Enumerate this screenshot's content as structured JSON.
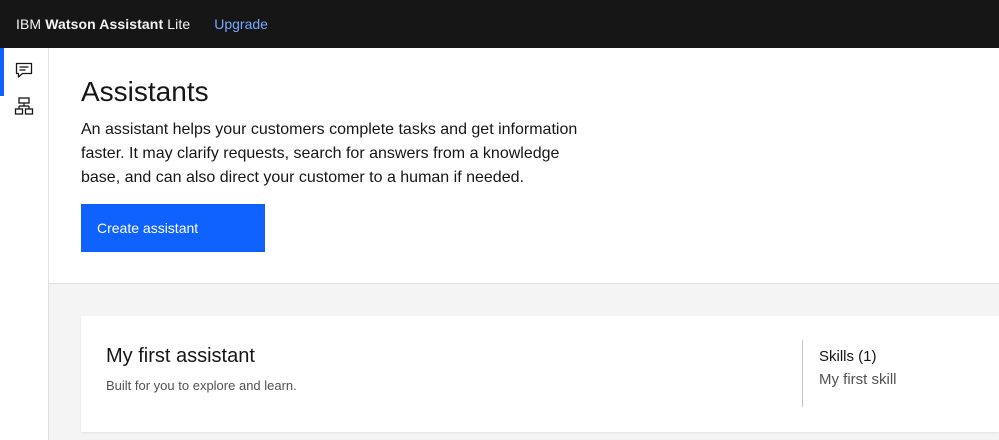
{
  "topbar": {
    "brand_prefix": "IBM",
    "brand_product": "Watson Assistant",
    "brand_plan": "Lite",
    "upgrade_label": "Upgrade"
  },
  "rail": {
    "items": [
      {
        "icon": "chat-icon",
        "active": true
      },
      {
        "icon": "skills-tree-icon",
        "active": false
      }
    ]
  },
  "main": {
    "title": "Assistants",
    "description": "An assistant helps your customers complete tasks and get information faster. It may clarify requests, search for answers from a knowledge base, and can also direct your customer to a human if needed.",
    "create_button_label": "Create assistant"
  },
  "assistants": [
    {
      "name": "My first assistant",
      "description": "Built for you to explore and learn.",
      "skills_heading": "Skills (1)",
      "skills": [
        "My first skill"
      ]
    }
  ],
  "colors": {
    "topbar_bg": "#161616",
    "accent": "#0f62fe",
    "link": "#78a9ff",
    "page_bg": "#f4f4f4"
  }
}
